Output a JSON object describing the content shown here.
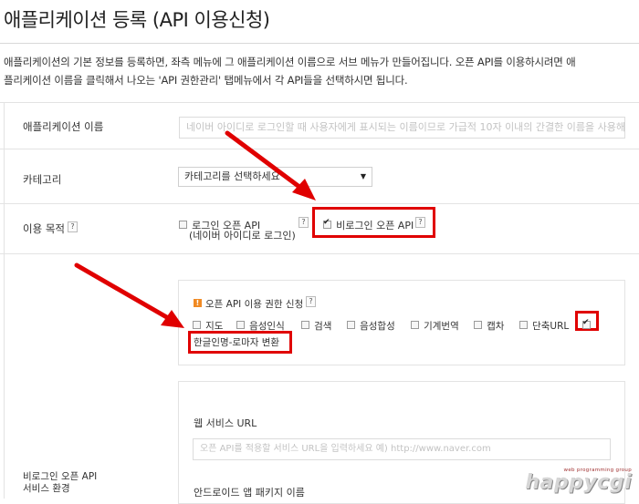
{
  "page": {
    "title": "애플리케이션 등록 (API 이용신청)",
    "desc_line1": "애플리케이션의 기본 정보를 등록하면, 좌측 메뉴에 그 애플리케이션 이름으로 서브 메뉴가 만들어집니다. 오픈 API를 이용하시려면 애",
    "desc_line2": "플리케이션 이름을 클릭해서 나오는 'API 권한관리' 탭메뉴에서 각 API들을 선택하시면 됩니다."
  },
  "form": {
    "app_name": {
      "label": "애플리케이션 이름",
      "placeholder": "네이버 아이디로 로그인할 때 사용자에게 표시되는 이름이므로 가급적 10자 이내의 간결한 이름을 사용해주세요"
    },
    "category": {
      "label": "카테고리",
      "selected": "카테고리를 선택하세요"
    },
    "purpose": {
      "label": "이용 목적",
      "help": "?",
      "option1_line1": "로그인 오픈 API",
      "option1_line2": "(네이버 아이디로 로그인)",
      "option1_checked": false,
      "option2": "비로그인 오픈 API",
      "option2_checked": true
    },
    "permission": {
      "title": "오픈 API 이용 권한 신청",
      "warn_icon": "!",
      "help": "?",
      "items": [
        {
          "label": "지도",
          "checked": false
        },
        {
          "label": "음성인식",
          "checked": false
        },
        {
          "label": "검색",
          "checked": false
        },
        {
          "label": "음성합성",
          "checked": false
        },
        {
          "label": "기계번역",
          "checked": false
        },
        {
          "label": "캡차",
          "checked": false
        },
        {
          "label": "단축URL",
          "checked": false
        },
        {
          "label": "",
          "checked": true
        }
      ],
      "extra_label": "한글인명-로마자 변환"
    },
    "service_env": {
      "label_line1": "비로그인 오픈 API",
      "label_line2": "서비스 환경",
      "web_url_label": "웹 서비스 URL",
      "web_url_placeholder": "오픈 API를 적용할 서비스 URL을 입력하세요 예) http://www.naver.com",
      "android_label": "안드로이드 앱 패키지 이름"
    }
  },
  "watermark": {
    "sub": "web programming group",
    "main": "happycgi"
  },
  "colors": {
    "highlight": "#e00000",
    "warn": "#f08a24"
  },
  "icons": {
    "help": "question-icon",
    "warn": "warning-icon",
    "checkbox": "checkbox-icon",
    "dropdown": "chevron-down-icon"
  }
}
